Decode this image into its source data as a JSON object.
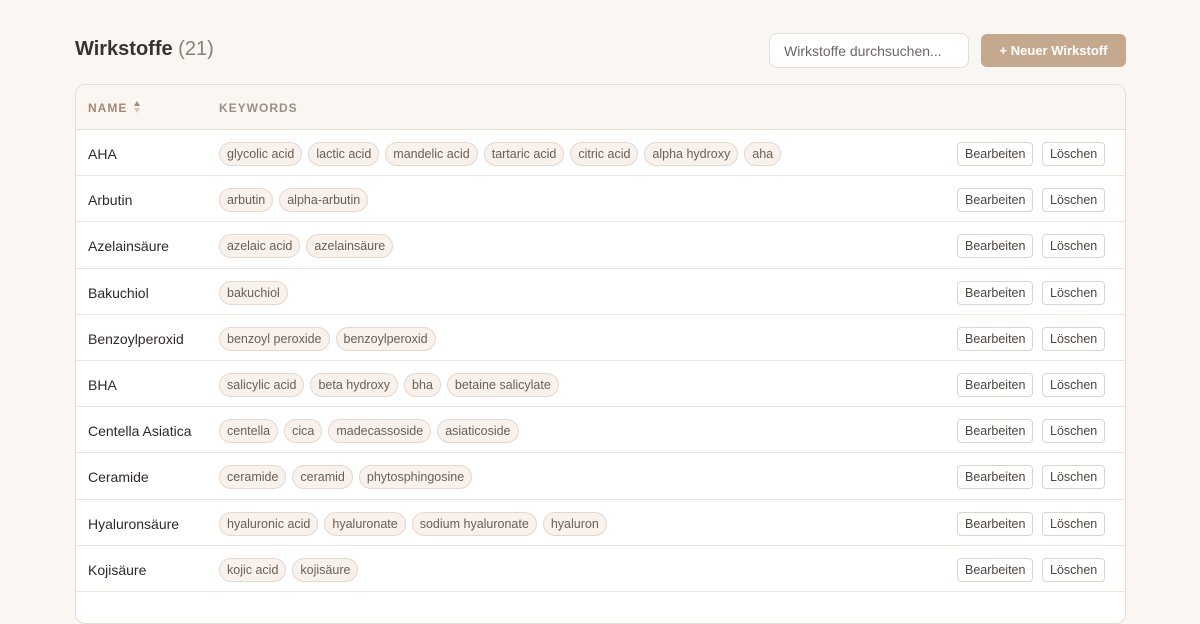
{
  "header": {
    "title": "Wirkstoffe",
    "count": "(21)",
    "search_placeholder": "Wirkstoffe durchsuchen...",
    "new_button": "+ Neuer Wirkstoff"
  },
  "table": {
    "col_name": "NAME",
    "col_keywords": "KEYWORDS",
    "sort_icon": "sort-asc-icon",
    "edit_label": "Bearbeiten",
    "delete_label": "Löschen",
    "rows": [
      {
        "name": "AHA",
        "keywords": [
          "glycolic acid",
          "lactic acid",
          "mandelic acid",
          "tartaric acid",
          "citric acid",
          "alpha hydroxy",
          "aha"
        ]
      },
      {
        "name": "Arbutin",
        "keywords": [
          "arbutin",
          "alpha-arbutin"
        ]
      },
      {
        "name": "Azelainsäure",
        "keywords": [
          "azelaic acid",
          "azelainsäure"
        ]
      },
      {
        "name": "Bakuchiol",
        "keywords": [
          "bakuchiol"
        ]
      },
      {
        "name": "Benzoylperoxid",
        "keywords": [
          "benzoyl peroxide",
          "benzoylperoxid"
        ]
      },
      {
        "name": "BHA",
        "keywords": [
          "salicylic acid",
          "beta hydroxy",
          "bha",
          "betaine salicylate"
        ]
      },
      {
        "name": "Centella Asiatica",
        "keywords": [
          "centella",
          "cica",
          "madecassoside",
          "asiaticoside"
        ]
      },
      {
        "name": "Ceramide",
        "keywords": [
          "ceramide",
          "ceramid",
          "phytosphingosine"
        ]
      },
      {
        "name": "Hyaluronsäure",
        "keywords": [
          "hyaluronic acid",
          "hyaluronate",
          "sodium hyaluronate",
          "hyaluron"
        ]
      },
      {
        "name": "Kojisäure",
        "keywords": [
          "kojic acid",
          "kojisäure"
        ]
      }
    ]
  },
  "colors": {
    "accent": "#c4a98f",
    "background": "#faf6f2",
    "tag_bg": "#f8f1ec"
  }
}
